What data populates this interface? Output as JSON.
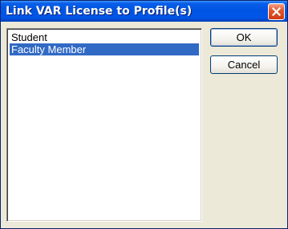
{
  "window": {
    "title": "Link VAR License to Profile(s)"
  },
  "profiles": {
    "items": [
      {
        "label": "Student",
        "selected": false
      },
      {
        "label": "Faculty Member",
        "selected": true
      }
    ]
  },
  "buttons": {
    "ok_label": "OK",
    "cancel_label": "Cancel"
  },
  "icons": {
    "close": "close-icon"
  },
  "colors": {
    "titlebar": "#0054E3",
    "selection": "#316AC5",
    "dialog_face": "#ECE9D8",
    "close_button": "#E2582F"
  }
}
